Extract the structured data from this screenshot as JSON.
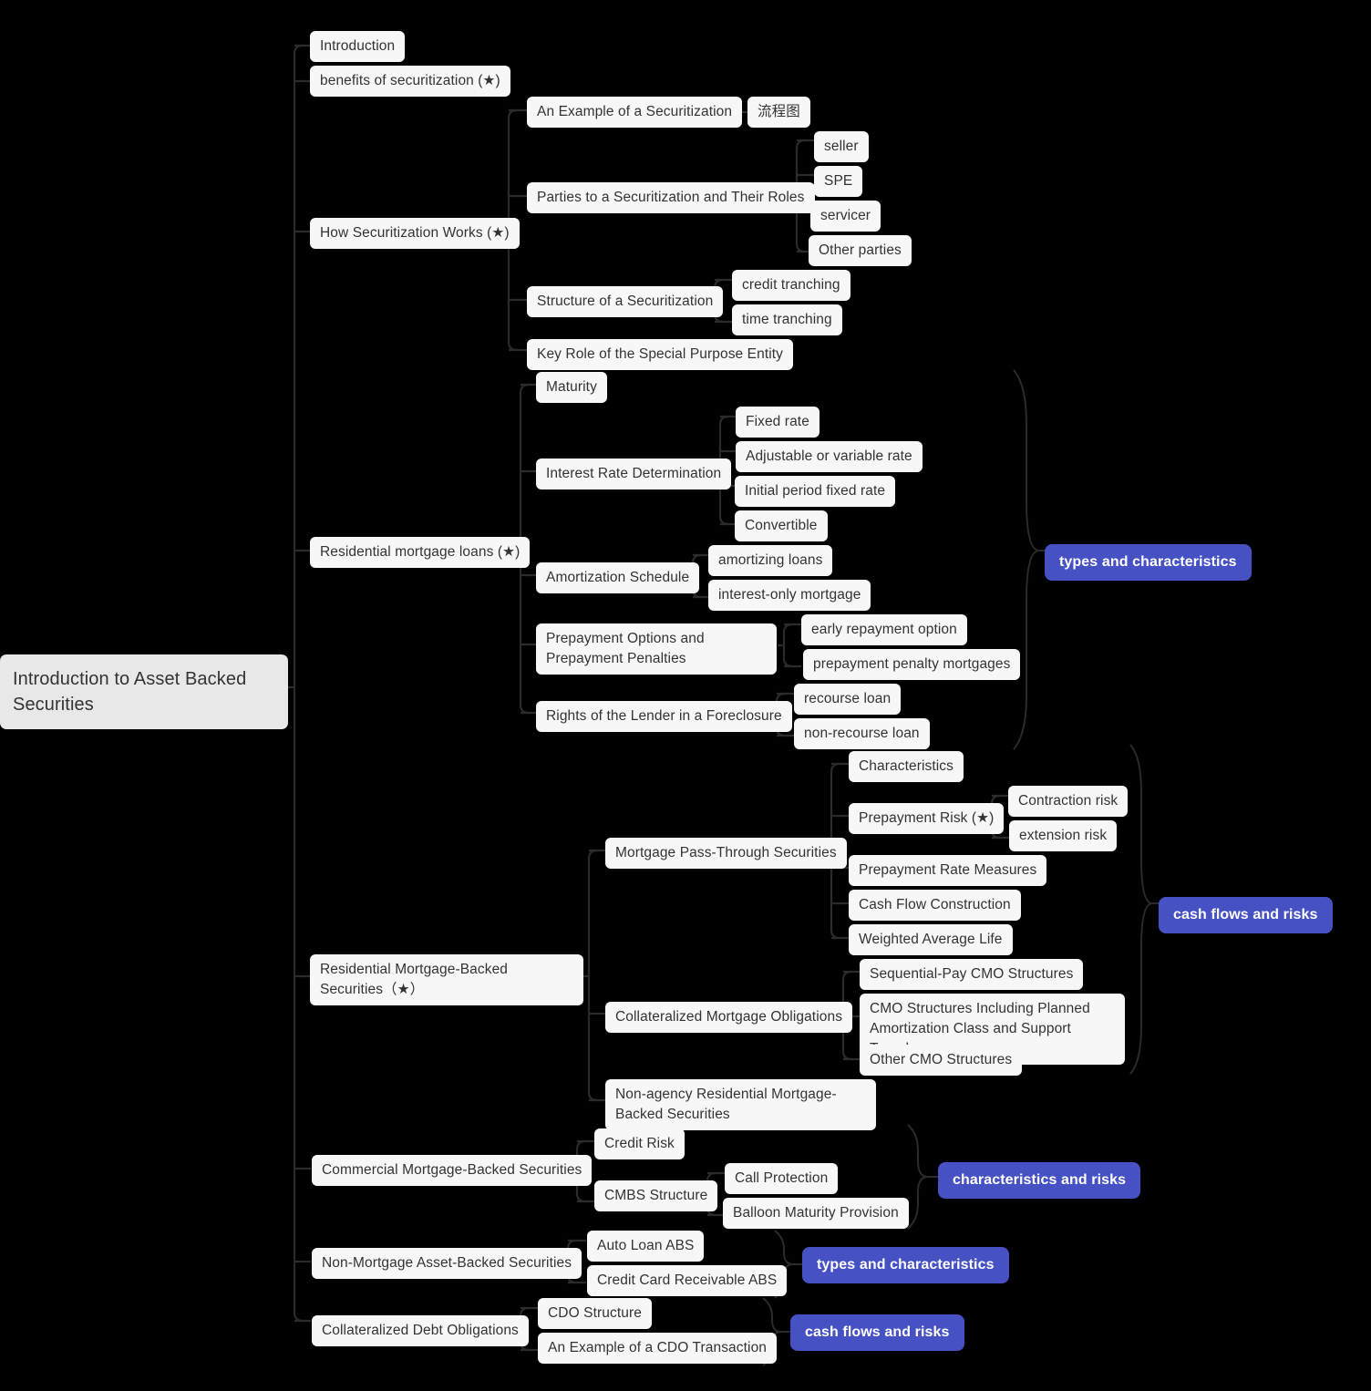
{
  "theme": {
    "background": "#000000",
    "node_bg": "#f7f7f7",
    "node_text": "#333333",
    "root_bg": "#e8e8e8",
    "badge_bg": "#4652c4",
    "badge_text": "#ffffff",
    "connector": "#2b2b2b"
  },
  "root": {
    "label": "Introduction to Asset Backed Securities"
  },
  "nodes": {
    "introduction": "Introduction",
    "benefits": "benefits of securitization (★)",
    "how_securitization_works": "How Securitization Works (★)",
    "an_example_of_a_securitization": "An Example of a Securitization",
    "flow_chart": "流程图",
    "parties": "Parties to a Securitization and Their Roles",
    "seller": "seller",
    "spe": "SPE",
    "servicer": "servicer",
    "other_parties": "Other parties",
    "structure_of_a_securitization": "Structure of a Securitization",
    "credit_tranching": "credit tranching",
    "time_tranching": "time tranching",
    "key_role_spe": "Key Role of the Special Purpose Entity",
    "residential_mortgage_loans": "Residential mortgage loans (★)",
    "maturity": "Maturity",
    "interest_rate_determination": "Interest Rate Determination",
    "fixed_rate": "Fixed rate",
    "adjustable_rate": "Adjustable or variable rate",
    "initial_period_fixed_rate": "Initial period fixed rate",
    "convertible": "Convertible",
    "amortization_schedule": "Amortization Schedule",
    "amortizing_loans": "amortizing loans",
    "interest_only_mortgage": "interest-only mortgage",
    "prepayment_options": "Prepayment Options and Prepayment Penalties",
    "early_repayment_option": "early repayment option",
    "prepayment_penalty_mortgages": "prepayment penalty mortgages",
    "rights_of_lender": "Rights of the Lender in a Foreclosure",
    "recourse_loan": "recourse loan",
    "non_recourse_loan": "non-recourse loan",
    "badge_types_characteristics_1": "types and characteristics",
    "rmbs": "Residential Mortgage-Backed Securities（★）",
    "mortgage_pass_through": "Mortgage Pass-Through Securities",
    "characteristics": "Characteristics",
    "prepayment_risk": "Prepayment Risk (★)",
    "contraction_risk": "Contraction risk",
    "extension_risk": "extension risk",
    "prepayment_rate_measures": "Prepayment Rate Measures",
    "cash_flow_construction": "Cash Flow Construction",
    "weighted_average_life": "Weighted Average Life",
    "cmo": "Collateralized Mortgage Obligations",
    "sequential_pay_cmo": "Sequential-Pay CMO Structures",
    "cmo_pac_support": "CMO Structures Including Planned Amortization Class and Support Tranches",
    "other_cmo_structures": "Other CMO Structures",
    "non_agency_rmbs": "Non-agency Residential Mortgage-Backed Securities",
    "badge_cash_flows_risks_1": "cash flows and risks",
    "cmbs": "Commercial Mortgage-Backed Securities",
    "credit_risk": "Credit Risk",
    "cmbs_structure": "CMBS Structure",
    "call_protection": "Call Protection",
    "balloon_maturity_provision": "Balloon Maturity Provision",
    "badge_characteristics_risks": "characteristics and risks",
    "non_mortgage_abs": "Non-Mortgage Asset-Backed Securities",
    "auto_loan_abs": "Auto Loan ABS",
    "credit_card_abs": "Credit Card Receivable ABS",
    "badge_types_characteristics_2": "types and characteristics",
    "cdo": "Collateralized Debt Obligations",
    "cdo_structure": "CDO Structure",
    "cdo_example": "An Example of a CDO Transaction",
    "badge_cash_flows_risks_2": "cash flows and risks"
  }
}
